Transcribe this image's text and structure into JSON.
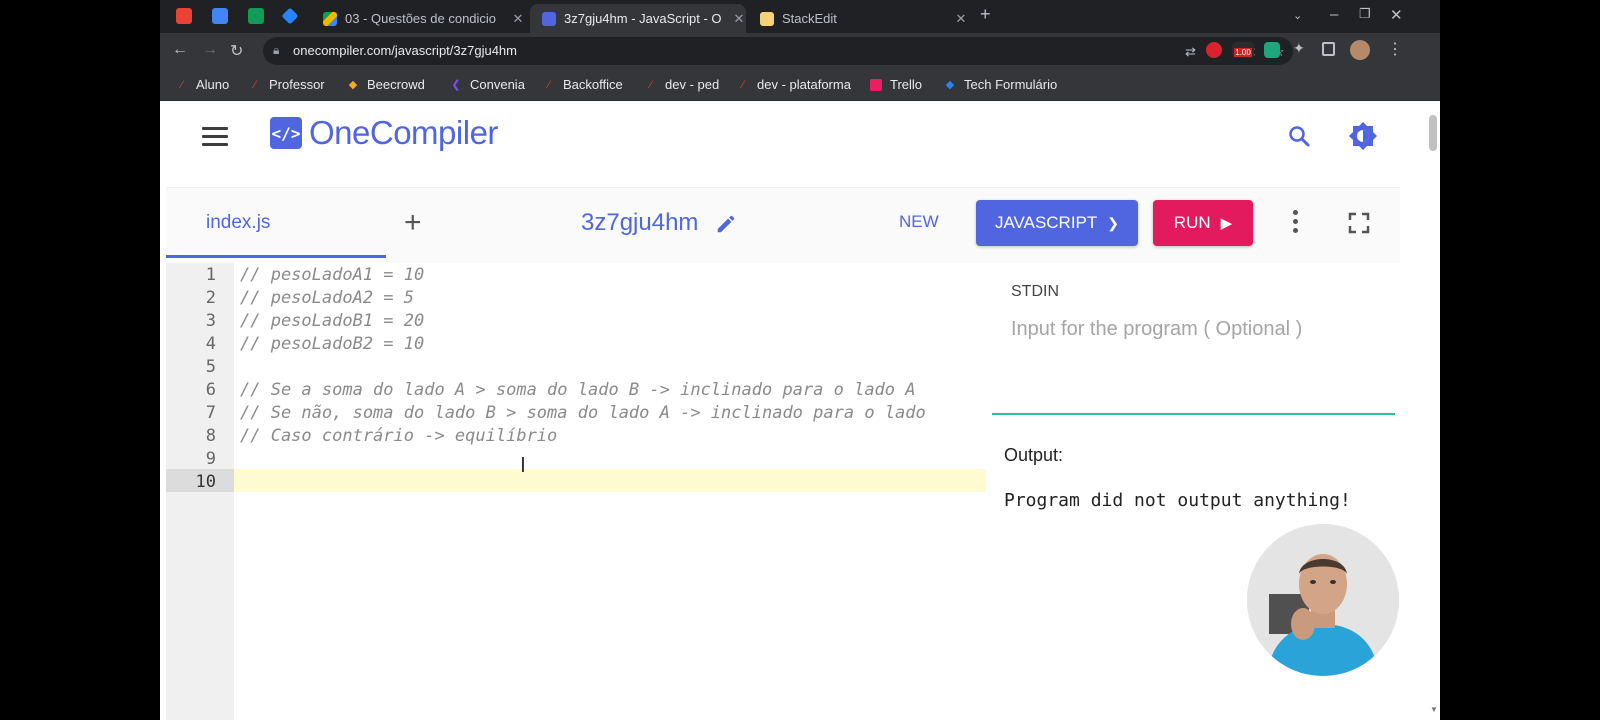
{
  "browser": {
    "tabs": [
      {
        "title": "03 - Questões de condicio",
        "active": false,
        "favicon": "drive-icon"
      },
      {
        "title": "3z7gju4hm - JavaScript - O",
        "active": true,
        "favicon": "onecompiler-icon"
      },
      {
        "title": "StackEdit",
        "active": false,
        "favicon": "stackedit-icon"
      }
    ],
    "url": "onecompiler.com/javascript/3z7gju4hm",
    "extension_badge": "1.00",
    "bookmarks": [
      {
        "label": "Aluno",
        "icon": "bookmark-icon"
      },
      {
        "label": "Professor",
        "icon": "bookmark-icon"
      },
      {
        "label": "Beecrowd",
        "icon": "beecrowd-icon"
      },
      {
        "label": "Convenia",
        "icon": "convenia-icon"
      },
      {
        "label": "Backoffice",
        "icon": "bookmark-icon"
      },
      {
        "label": "dev - ped",
        "icon": "bookmark-icon"
      },
      {
        "label": "dev - plataforma",
        "icon": "bookmark-icon"
      },
      {
        "label": "Trello",
        "icon": "trello-icon"
      },
      {
        "label": "Tech Formulário",
        "icon": "jira-icon"
      }
    ]
  },
  "app": {
    "logo": "OneCompiler",
    "logo_mark": "</>",
    "colors": {
      "brand": "#4f66e0",
      "run": "#e31b5e",
      "divider": "#2dbf9c"
    }
  },
  "toolbar": {
    "file_tab": "index.js",
    "program_name": "3z7gju4hm",
    "new_label": "NEW",
    "language_label": "JAVASCRIPT",
    "run_label": "RUN"
  },
  "editor": {
    "lines": [
      {
        "num": "1",
        "text": "// pesoLadoA1 = 10"
      },
      {
        "num": "2",
        "text": "// pesoLadoA2 = 5"
      },
      {
        "num": "3",
        "text": "// pesoLadoB1 = 20"
      },
      {
        "num": "4",
        "text": "// pesoLadoB2 = 10"
      },
      {
        "num": "5",
        "text": ""
      },
      {
        "num": "6",
        "text": "// Se a soma do lado A > soma do lado B -> inclinado para o lado A"
      },
      {
        "num": "7",
        "text": "// Se não, soma do lado B > soma do lado A -> inclinado para o lado"
      },
      {
        "num": "8",
        "text": "// Caso contrário -> equilíbrio"
      },
      {
        "num": "9",
        "text": ""
      },
      {
        "num": "10",
        "text": ""
      }
    ],
    "active_line": 10
  },
  "io": {
    "stdin_label": "STDIN",
    "stdin_placeholder": "Input for the program ( Optional )",
    "output_label": "Output:",
    "output_text": "Program did not output anything!"
  }
}
